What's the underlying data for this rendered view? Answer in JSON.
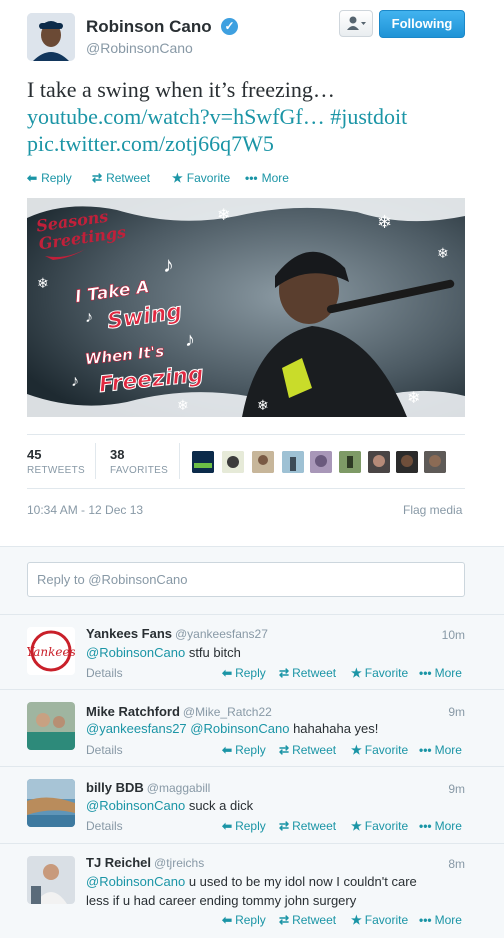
{
  "tweet": {
    "author_name": "Robinson Cano",
    "author_handle": "@RobinsonCano",
    "verified": true,
    "follow_button": "Following",
    "text_main": "I take a swing when it’s freezing…",
    "link": "youtube.com/watch?v=hSwfGf…",
    "hashtag": "#justdoit",
    "pic_link": "pic.twitter.com/zotj66q7W5",
    "actions": {
      "reply": "Reply",
      "retweet": "Retweet",
      "favorite": "Favorite",
      "more": "More"
    },
    "media": {
      "seasons": "Seasons",
      "greetings": "Greetings",
      "line1": "I Take A",
      "line2": "Swing",
      "line3": "When It's",
      "line4": "Freezing"
    },
    "stats": {
      "retweets": "45",
      "retweets_label": "RETWEETS",
      "favorites": "38",
      "favorites_label": "FAVORITES"
    },
    "timestamp": "10:34 AM - 12 Dec 13",
    "flag_media": "Flag media"
  },
  "reply_box": {
    "placeholder": "Reply to @RobinsonCano"
  },
  "reply_actions": {
    "reply": "Reply",
    "retweet": "Retweet",
    "favorite": "Favorite",
    "more": "More",
    "details": "Details"
  },
  "replies": [
    {
      "name": "Yankees Fans",
      "handle": "@yankeesfans27",
      "time": "10m",
      "mention": "@RobinsonCano",
      "text": " stfu bitch"
    },
    {
      "name": "Mike Ratchford",
      "handle": "@Mike_Ratch22",
      "time": "9m",
      "mention": "@yankeesfans27 @RobinsonCano",
      "text": " hahahaha yes!"
    },
    {
      "name": "billy BDB",
      "handle": "@maggabill",
      "time": "9m",
      "mention": "@RobinsonCano",
      "text": " suck a dick"
    },
    {
      "name": "TJ Reichel",
      "handle": "@tjreichs",
      "time": "8m",
      "mention": "@RobinsonCano",
      "text": " u used to be my idol now I couldn't care less if u had career ending tommy john surgery"
    }
  ],
  "colors": {
    "accent": "#1b95a6",
    "follow": "#2a9fe0"
  }
}
